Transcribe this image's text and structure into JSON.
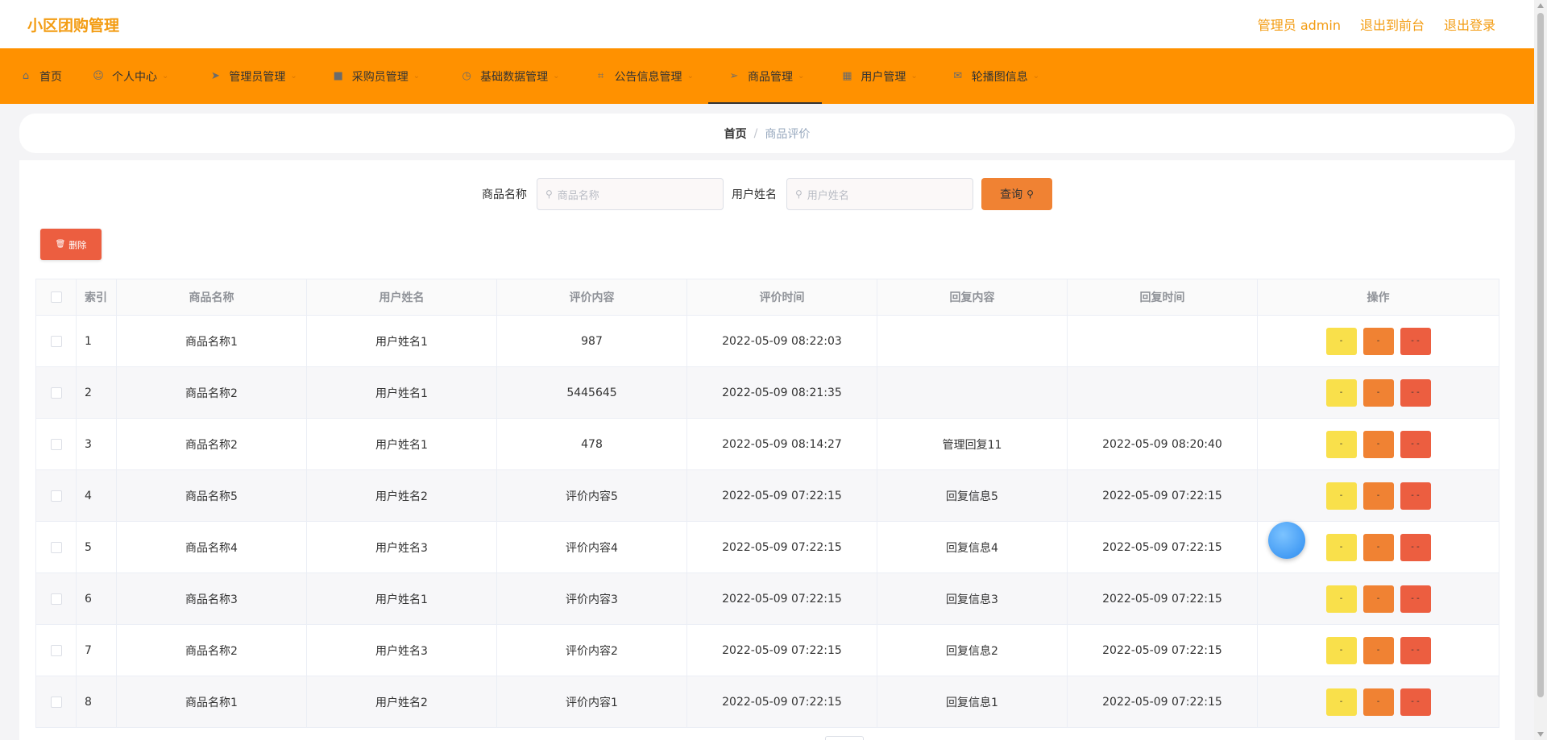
{
  "header": {
    "brand": "小区团购管理",
    "admin_label": "管理员 admin",
    "to_front": "退出到前台",
    "logout": "退出登录"
  },
  "nav": [
    {
      "label": "首页",
      "icon": "home-icon",
      "caret": false,
      "active": false
    },
    {
      "label": "个人中心",
      "icon": "user-icon",
      "caret": true,
      "active": false
    },
    {
      "label": "管理员管理",
      "icon": "send-icon",
      "caret": true,
      "active": false
    },
    {
      "label": "采购员管理",
      "icon": "monitor-icon",
      "caret": true,
      "active": false
    },
    {
      "label": "基础数据管理",
      "icon": "clock-icon",
      "caret": true,
      "active": false
    },
    {
      "label": "公告信息管理",
      "icon": "crop-icon",
      "caret": true,
      "active": false
    },
    {
      "label": "商品管理",
      "icon": "location-icon",
      "caret": true,
      "active": true
    },
    {
      "label": "用户管理",
      "icon": "calendar-icon",
      "caret": true,
      "active": false
    },
    {
      "label": "轮播图信息",
      "icon": "message-icon",
      "caret": true,
      "active": false
    }
  ],
  "breadcrumb": {
    "home": "首页",
    "separator": "/",
    "current": "商品评价"
  },
  "search": {
    "name_label": "商品名称",
    "name_placeholder": "商品名称",
    "user_label": "用户姓名",
    "user_placeholder": "用户姓名",
    "query_label": "查询"
  },
  "delete_label": "删除",
  "table": {
    "headers": [
      "索引",
      "商品名称",
      "用户姓名",
      "评价内容",
      "评价时间",
      "回复内容",
      "回复时间",
      "操作"
    ],
    "rows": [
      {
        "idx": "1",
        "product": "商品名称1",
        "user": "用户姓名1",
        "content": "987",
        "time": "2022-05-09 08:22:03",
        "reply": "",
        "reply_time": ""
      },
      {
        "idx": "2",
        "product": "商品名称2",
        "user": "用户姓名1",
        "content": "5445645",
        "time": "2022-05-09 08:21:35",
        "reply": "",
        "reply_time": ""
      },
      {
        "idx": "3",
        "product": "商品名称2",
        "user": "用户姓名1",
        "content": "478",
        "time": "2022-05-09 08:14:27",
        "reply": "管理回复11",
        "reply_time": "2022-05-09 08:20:40"
      },
      {
        "idx": "4",
        "product": "商品名称5",
        "user": "用户姓名2",
        "content": "评价内容5",
        "time": "2022-05-09 07:22:15",
        "reply": "回复信息5",
        "reply_time": "2022-05-09 07:22:15"
      },
      {
        "idx": "5",
        "product": "商品名称4",
        "user": "用户姓名3",
        "content": "评价内容4",
        "time": "2022-05-09 07:22:15",
        "reply": "回复信息4",
        "reply_time": "2022-05-09 07:22:15"
      },
      {
        "idx": "6",
        "product": "商品名称3",
        "user": "用户姓名1",
        "content": "评价内容3",
        "time": "2022-05-09 07:22:15",
        "reply": "回复信息3",
        "reply_time": "2022-05-09 07:22:15"
      },
      {
        "idx": "7",
        "product": "商品名称2",
        "user": "用户姓名3",
        "content": "评价内容2",
        "time": "2022-05-09 07:22:15",
        "reply": "回复信息2",
        "reply_time": "2022-05-09 07:22:15"
      },
      {
        "idx": "8",
        "product": "商品名称1",
        "user": "用户姓名2",
        "content": "评价内容1",
        "time": "2022-05-09 07:22:15",
        "reply": "回复信息1",
        "reply_time": "2022-05-09 07:22:15"
      }
    ],
    "op_labels": [
      "-",
      "-",
      "- -"
    ]
  },
  "colors": {
    "brand": "#f39c12",
    "nav_bg": "#ff9100",
    "query_btn": "#f08233",
    "delete_btn": "#ec5e40",
    "op_yellow": "#f9e04b",
    "op_orange": "#f08233",
    "op_red": "#ec5e40"
  }
}
